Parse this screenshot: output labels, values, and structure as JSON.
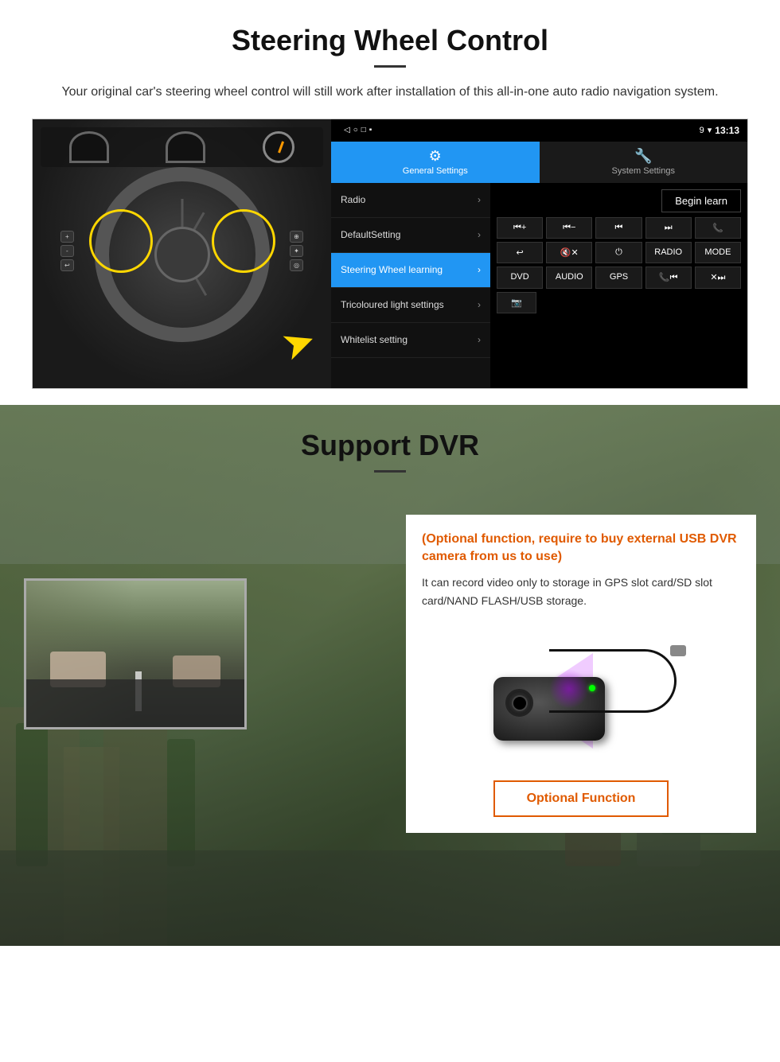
{
  "section1": {
    "title": "Steering Wheel Control",
    "description": "Your original car's steering wheel control will still work after installation of this all-in-one auto radio navigation system.",
    "android": {
      "statusbar": {
        "time": "13:13",
        "signal": "▼",
        "wifi": "▲"
      },
      "nav_buttons": [
        "◁",
        "○",
        "□",
        "■"
      ],
      "tabs": [
        {
          "label": "General Settings",
          "icon": "⚙"
        },
        {
          "label": "System Settings",
          "icon": "🔧"
        }
      ],
      "menu_items": [
        {
          "label": "Radio",
          "active": false
        },
        {
          "label": "DefaultSetting",
          "active": false
        },
        {
          "label": "Steering Wheel learning",
          "active": true
        },
        {
          "label": "Tricoloured light settings",
          "active": false
        },
        {
          "label": "Whitelist setting",
          "active": false
        }
      ],
      "begin_learn": "Begin learn",
      "control_buttons": [
        [
          "⏮+",
          "⏮-",
          "⏮",
          "⏭",
          "📞"
        ],
        [
          "↩",
          "🔇✕",
          "⏻",
          "RADIO",
          "MODE"
        ],
        [
          "DVD",
          "AUDIO",
          "GPS",
          "📞⏮",
          "✕⏭"
        ],
        [
          "📷"
        ]
      ]
    }
  },
  "section2": {
    "title": "Support DVR",
    "optional_title": "(Optional function, require to buy external USB DVR camera from us to use)",
    "description": "It can record video only to storage in GPS slot card/SD slot card/NAND FLASH/USB storage.",
    "optional_button": "Optional Function"
  }
}
